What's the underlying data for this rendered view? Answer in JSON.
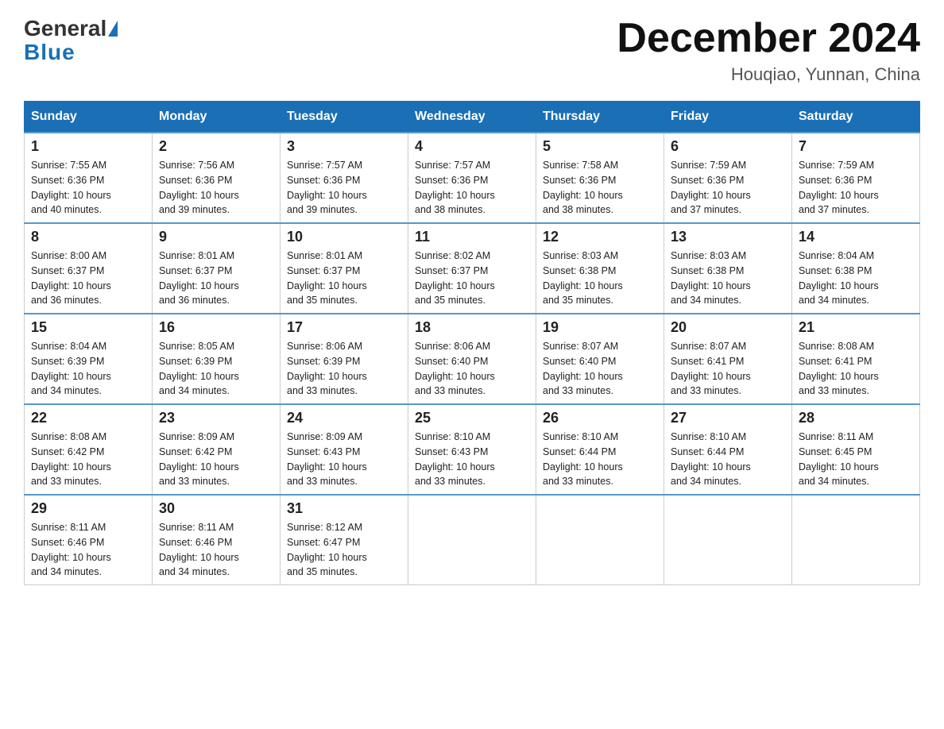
{
  "logo": {
    "general": "General",
    "triangle": "▲",
    "blue": "Blue"
  },
  "title": "December 2024",
  "location": "Houqiao, Yunnan, China",
  "days_of_week": [
    "Sunday",
    "Monday",
    "Tuesday",
    "Wednesday",
    "Thursday",
    "Friday",
    "Saturday"
  ],
  "weeks": [
    [
      {
        "day": "1",
        "sunrise": "7:55 AM",
        "sunset": "6:36 PM",
        "daylight": "10 hours and 40 minutes."
      },
      {
        "day": "2",
        "sunrise": "7:56 AM",
        "sunset": "6:36 PM",
        "daylight": "10 hours and 39 minutes."
      },
      {
        "day": "3",
        "sunrise": "7:57 AM",
        "sunset": "6:36 PM",
        "daylight": "10 hours and 39 minutes."
      },
      {
        "day": "4",
        "sunrise": "7:57 AM",
        "sunset": "6:36 PM",
        "daylight": "10 hours and 38 minutes."
      },
      {
        "day": "5",
        "sunrise": "7:58 AM",
        "sunset": "6:36 PM",
        "daylight": "10 hours and 38 minutes."
      },
      {
        "day": "6",
        "sunrise": "7:59 AM",
        "sunset": "6:36 PM",
        "daylight": "10 hours and 37 minutes."
      },
      {
        "day": "7",
        "sunrise": "7:59 AM",
        "sunset": "6:36 PM",
        "daylight": "10 hours and 37 minutes."
      }
    ],
    [
      {
        "day": "8",
        "sunrise": "8:00 AM",
        "sunset": "6:37 PM",
        "daylight": "10 hours and 36 minutes."
      },
      {
        "day": "9",
        "sunrise": "8:01 AM",
        "sunset": "6:37 PM",
        "daylight": "10 hours and 36 minutes."
      },
      {
        "day": "10",
        "sunrise": "8:01 AM",
        "sunset": "6:37 PM",
        "daylight": "10 hours and 35 minutes."
      },
      {
        "day": "11",
        "sunrise": "8:02 AM",
        "sunset": "6:37 PM",
        "daylight": "10 hours and 35 minutes."
      },
      {
        "day": "12",
        "sunrise": "8:03 AM",
        "sunset": "6:38 PM",
        "daylight": "10 hours and 35 minutes."
      },
      {
        "day": "13",
        "sunrise": "8:03 AM",
        "sunset": "6:38 PM",
        "daylight": "10 hours and 34 minutes."
      },
      {
        "day": "14",
        "sunrise": "8:04 AM",
        "sunset": "6:38 PM",
        "daylight": "10 hours and 34 minutes."
      }
    ],
    [
      {
        "day": "15",
        "sunrise": "8:04 AM",
        "sunset": "6:39 PM",
        "daylight": "10 hours and 34 minutes."
      },
      {
        "day": "16",
        "sunrise": "8:05 AM",
        "sunset": "6:39 PM",
        "daylight": "10 hours and 34 minutes."
      },
      {
        "day": "17",
        "sunrise": "8:06 AM",
        "sunset": "6:39 PM",
        "daylight": "10 hours and 33 minutes."
      },
      {
        "day": "18",
        "sunrise": "8:06 AM",
        "sunset": "6:40 PM",
        "daylight": "10 hours and 33 minutes."
      },
      {
        "day": "19",
        "sunrise": "8:07 AM",
        "sunset": "6:40 PM",
        "daylight": "10 hours and 33 minutes."
      },
      {
        "day": "20",
        "sunrise": "8:07 AM",
        "sunset": "6:41 PM",
        "daylight": "10 hours and 33 minutes."
      },
      {
        "day": "21",
        "sunrise": "8:08 AM",
        "sunset": "6:41 PM",
        "daylight": "10 hours and 33 minutes."
      }
    ],
    [
      {
        "day": "22",
        "sunrise": "8:08 AM",
        "sunset": "6:42 PM",
        "daylight": "10 hours and 33 minutes."
      },
      {
        "day": "23",
        "sunrise": "8:09 AM",
        "sunset": "6:42 PM",
        "daylight": "10 hours and 33 minutes."
      },
      {
        "day": "24",
        "sunrise": "8:09 AM",
        "sunset": "6:43 PM",
        "daylight": "10 hours and 33 minutes."
      },
      {
        "day": "25",
        "sunrise": "8:10 AM",
        "sunset": "6:43 PM",
        "daylight": "10 hours and 33 minutes."
      },
      {
        "day": "26",
        "sunrise": "8:10 AM",
        "sunset": "6:44 PM",
        "daylight": "10 hours and 33 minutes."
      },
      {
        "day": "27",
        "sunrise": "8:10 AM",
        "sunset": "6:44 PM",
        "daylight": "10 hours and 34 minutes."
      },
      {
        "day": "28",
        "sunrise": "8:11 AM",
        "sunset": "6:45 PM",
        "daylight": "10 hours and 34 minutes."
      }
    ],
    [
      {
        "day": "29",
        "sunrise": "8:11 AM",
        "sunset": "6:46 PM",
        "daylight": "10 hours and 34 minutes."
      },
      {
        "day": "30",
        "sunrise": "8:11 AM",
        "sunset": "6:46 PM",
        "daylight": "10 hours and 34 minutes."
      },
      {
        "day": "31",
        "sunrise": "8:12 AM",
        "sunset": "6:47 PM",
        "daylight": "10 hours and 35 minutes."
      },
      null,
      null,
      null,
      null
    ]
  ],
  "labels": {
    "sunrise": "Sunrise:",
    "sunset": "Sunset:",
    "daylight": "Daylight:"
  }
}
